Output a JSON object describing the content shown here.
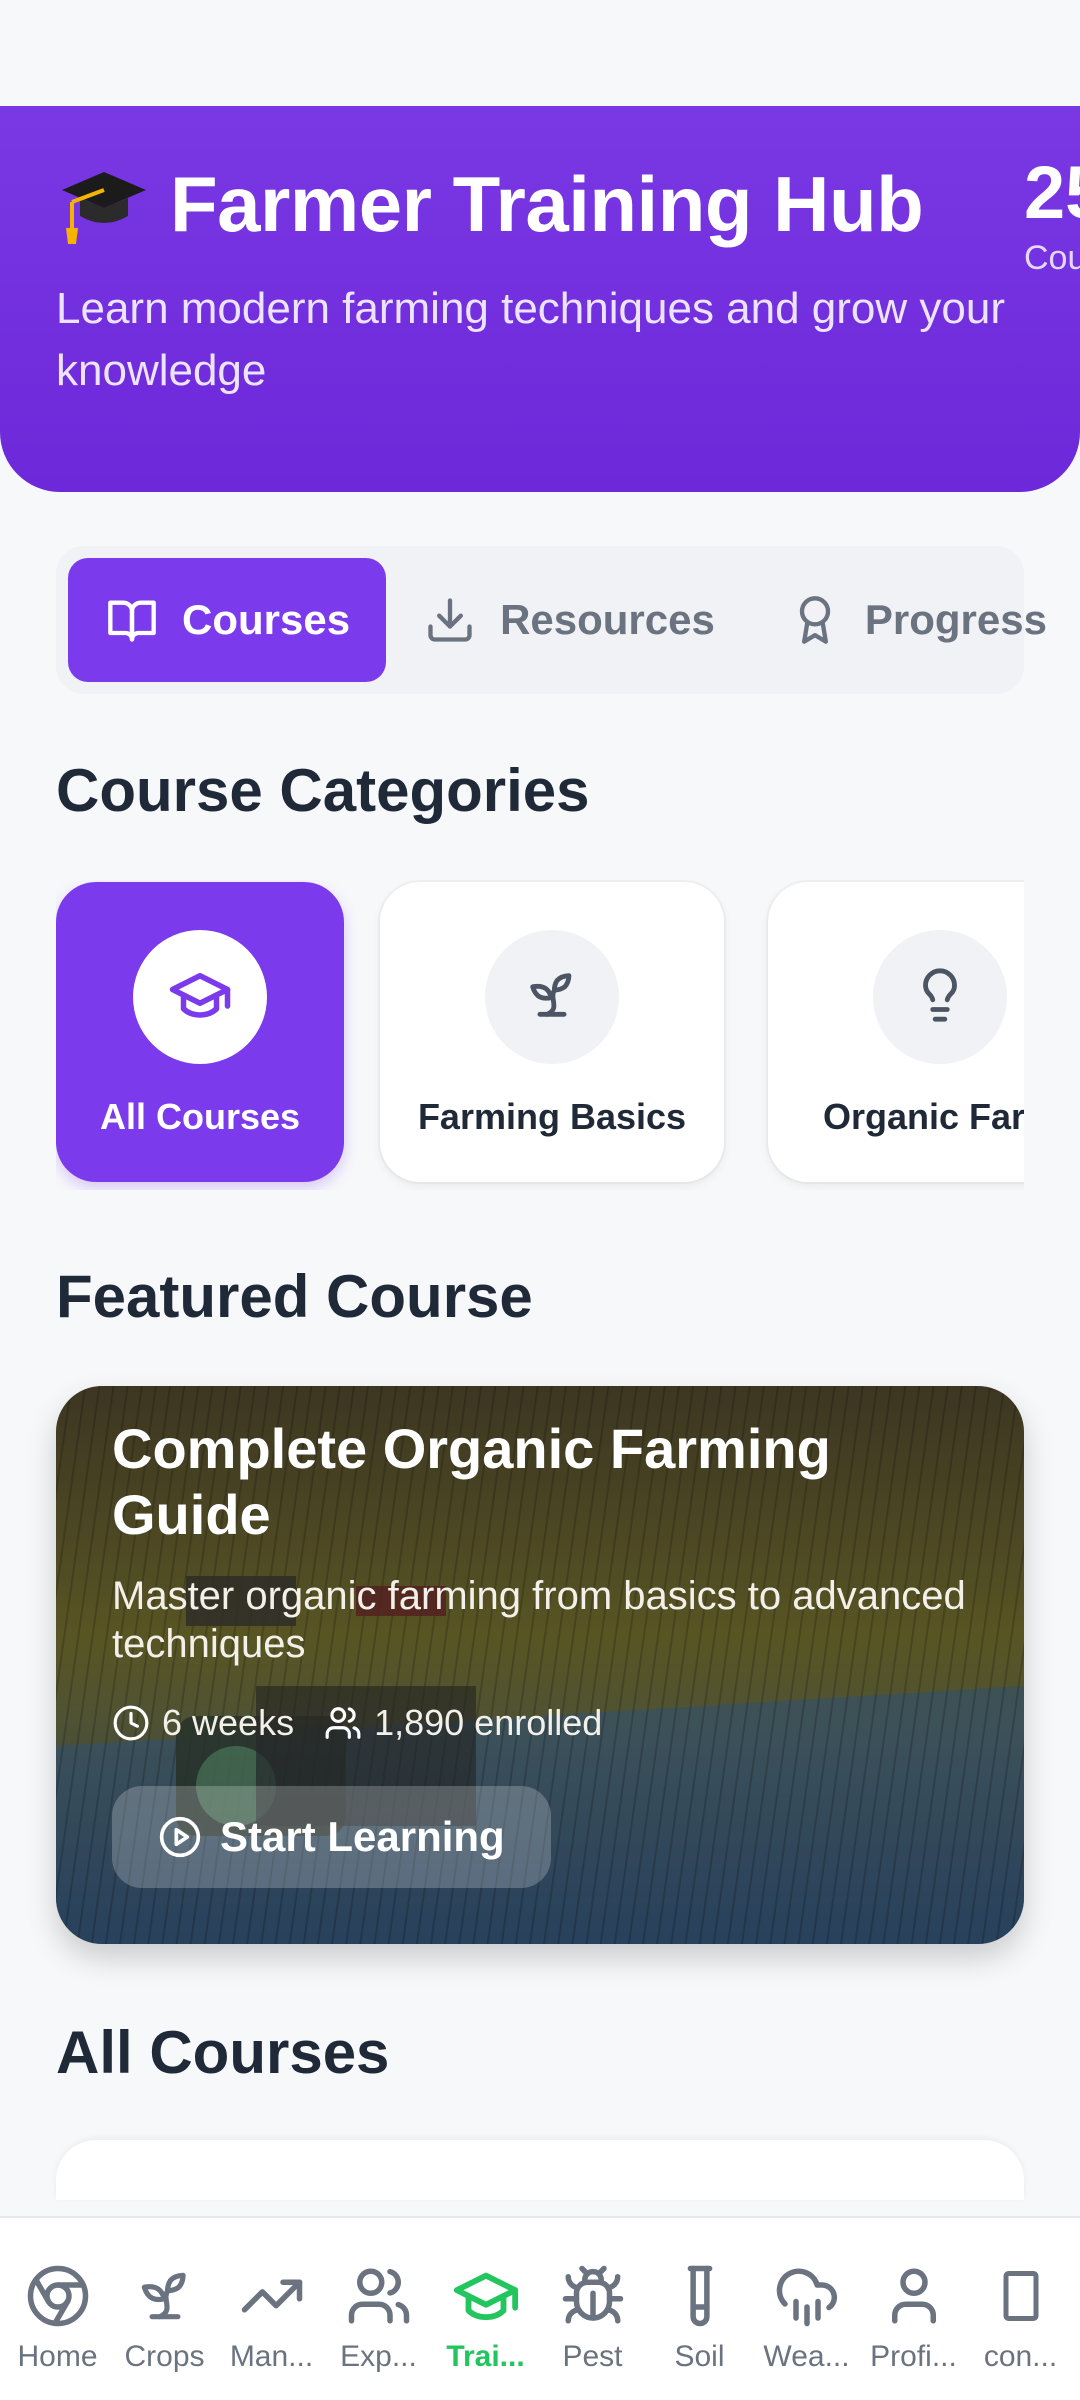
{
  "hero": {
    "title": "Farmer Training Hub",
    "subtitle": "Learn modern farming techniques and grow your knowledge",
    "stat_value": "25",
    "stat_label": "Cou",
    "cap_icon": "graduation-cap-emoji"
  },
  "tabs": [
    {
      "label": "Courses",
      "icon": "book-open-icon",
      "active": true
    },
    {
      "label": "Resources",
      "icon": "download-icon",
      "active": false
    },
    {
      "label": "Progress",
      "icon": "award-icon",
      "active": false
    }
  ],
  "categories": {
    "title": "Course Categories",
    "items": [
      {
        "label": "All Courses",
        "icon": "graduation-cap-icon",
        "active": true
      },
      {
        "label": "Farming Basics",
        "icon": "sprout-icon",
        "active": false
      },
      {
        "label": "Organic Farm",
        "icon": "lightbulb-icon",
        "active": false
      }
    ]
  },
  "featured": {
    "section_title": "Featured Course",
    "title": "Complete Organic Farming Guide",
    "description": "Master organic farming from basics to advanced techniques",
    "duration": "6 weeks",
    "enrolled": "1,890 enrolled",
    "button_label": "Start Learning"
  },
  "all_courses": {
    "title": "All Courses"
  },
  "bottom_nav": {
    "items": [
      {
        "label": "Home",
        "icon": "chrome-icon",
        "active": false
      },
      {
        "label": "Crops",
        "icon": "sprout-icon",
        "active": false
      },
      {
        "label": "Man...",
        "icon": "trending-up-icon",
        "active": false
      },
      {
        "label": "Exp...",
        "icon": "users-icon",
        "active": false
      },
      {
        "label": "Trai...",
        "icon": "graduation-cap-icon",
        "active": true
      },
      {
        "label": "Pest",
        "icon": "bug-icon",
        "active": false
      },
      {
        "label": "Soil",
        "icon": "test-tube-icon",
        "active": false
      },
      {
        "label": "Wea...",
        "icon": "cloud-rain-icon",
        "active": false
      },
      {
        "label": "Profi...",
        "icon": "user-icon",
        "active": false
      },
      {
        "label": "con...",
        "icon": "smartphone-icon",
        "active": false
      }
    ]
  },
  "colors": {
    "primary": "#7c3aed",
    "nav_active": "#22c55e",
    "background": "#f7f8fa"
  }
}
